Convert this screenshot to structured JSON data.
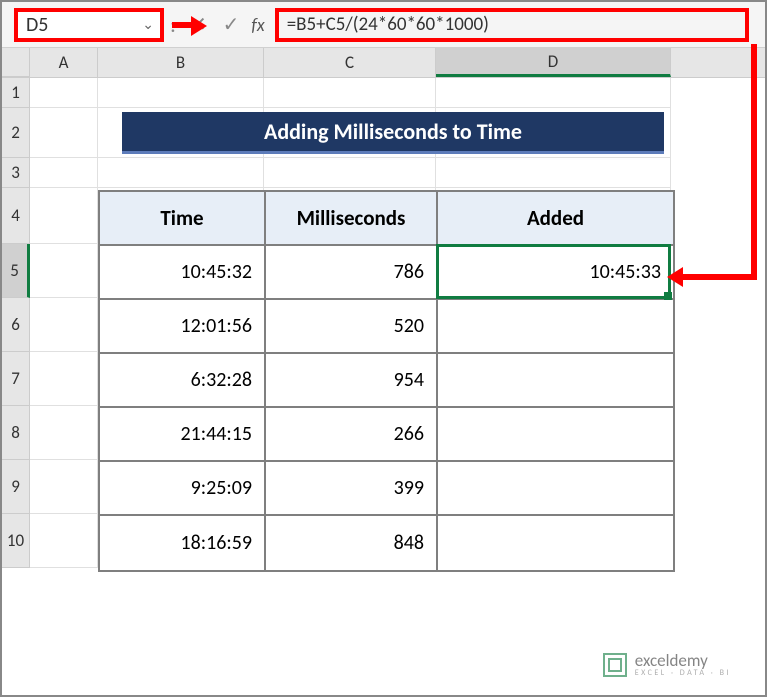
{
  "formula_bar": {
    "cell_reference": "D5",
    "formula": "=B5+C5/(24*60*60*1000)"
  },
  "column_headers": [
    "A",
    "B",
    "C",
    "D"
  ],
  "row_headers": [
    "1",
    "2",
    "3",
    "4",
    "5",
    "6",
    "7",
    "8",
    "9",
    "10"
  ],
  "sheet_title": "Adding Milliseconds to Time",
  "table": {
    "headers": [
      "Time",
      "Milliseconds",
      "Added"
    ],
    "rows": [
      {
        "time": "10:45:32",
        "ms": "786",
        "added": "10:45:33"
      },
      {
        "time": "12:01:56",
        "ms": "520",
        "added": ""
      },
      {
        "time": "6:32:28",
        "ms": "954",
        "added": ""
      },
      {
        "time": "21:44:15",
        "ms": "266",
        "added": ""
      },
      {
        "time": "9:25:09",
        "ms": "399",
        "added": ""
      },
      {
        "time": "18:16:59",
        "ms": "848",
        "added": ""
      }
    ]
  },
  "watermark": {
    "brand": "exceldemy",
    "tagline": "EXCEL · DATA · BI"
  },
  "chart_data": {
    "type": "table",
    "title": "Adding Milliseconds to Time",
    "columns": [
      "Time",
      "Milliseconds",
      "Added"
    ],
    "rows": [
      [
        "10:45:32",
        786,
        "10:45:33"
      ],
      [
        "12:01:56",
        520,
        null
      ],
      [
        "6:32:28",
        954,
        null
      ],
      [
        "21:44:15",
        266,
        null
      ],
      [
        "9:25:09",
        399,
        null
      ],
      [
        "18:16:59",
        848,
        null
      ]
    ],
    "formula": "=B5+C5/(24*60*60*1000)",
    "selected_cell": "D5"
  }
}
